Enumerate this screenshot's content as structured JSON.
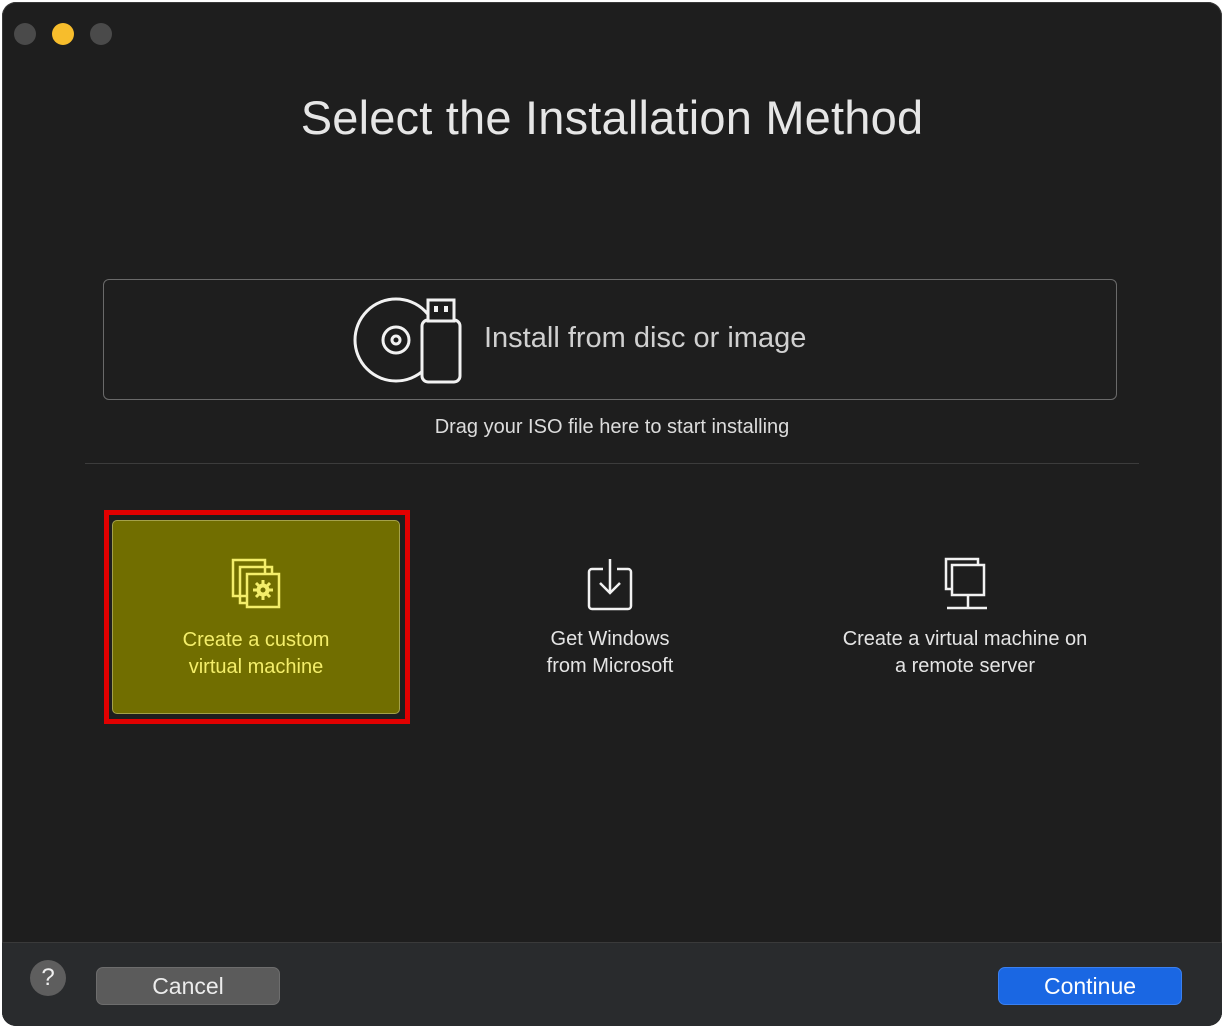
{
  "window": {
    "title": "Select the Installation Method"
  },
  "disc_panel": {
    "label": "Install from disc or image",
    "icon": "disc-usb-icon",
    "hint": "Drag your ISO file here to start installing"
  },
  "options": [
    {
      "label_line1": "Create a custom",
      "label_line2": "virtual machine",
      "icon": "custom-vm-gear-icon",
      "selected": true
    },
    {
      "label_line1": "Get Windows",
      "label_line2": "from Microsoft",
      "icon": "download-icon",
      "selected": false
    },
    {
      "label_line1": "Create a virtual machine on",
      "label_line2": "a remote server",
      "icon": "remote-server-icon",
      "selected": false
    }
  ],
  "footer": {
    "help_label": "?",
    "cancel_label": "Cancel",
    "continue_label": "Continue"
  },
  "colors": {
    "background": "#1e1e1e",
    "selected_fill": "#716e00",
    "selected_text": "#f4ee6a",
    "highlight_outline": "#e10000",
    "primary_button": "#1a67e3"
  }
}
